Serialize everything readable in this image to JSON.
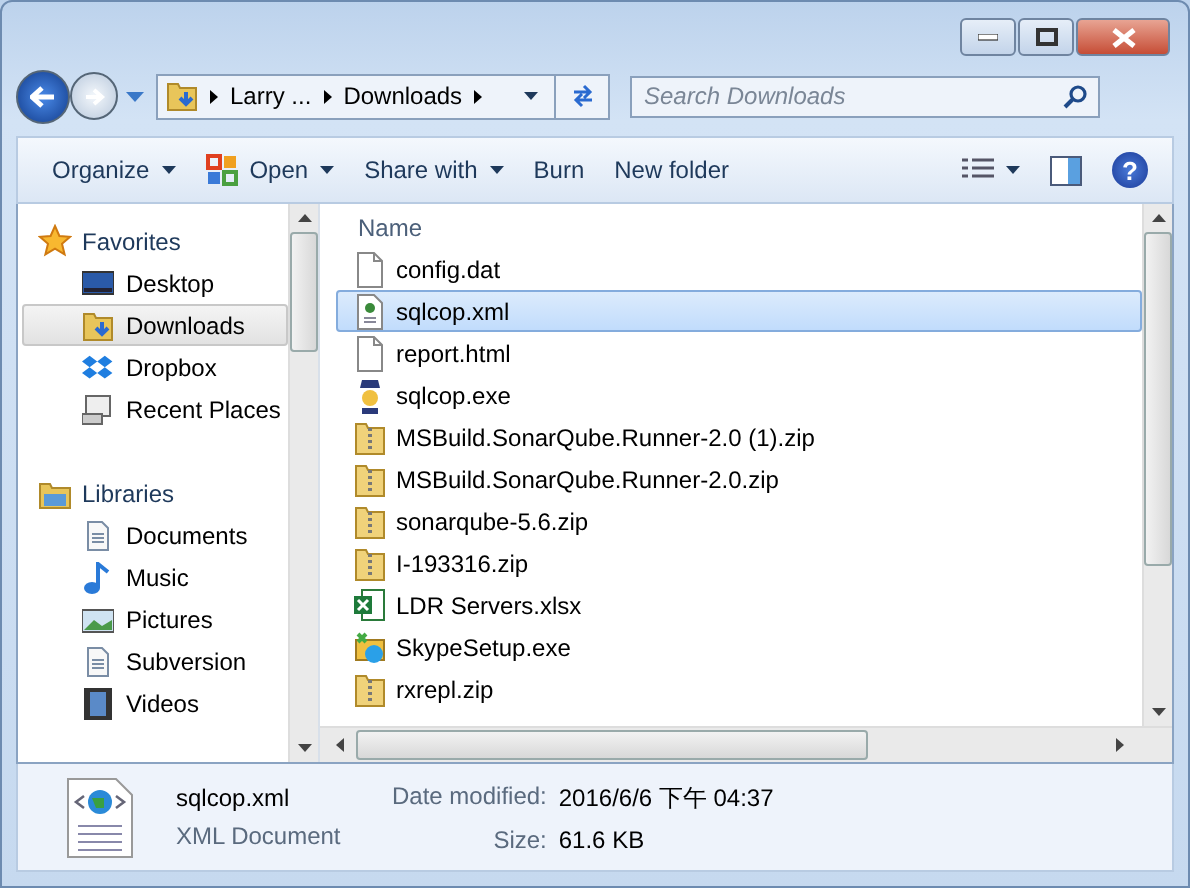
{
  "navigation": {
    "breadcrumb": [
      "Larry ...",
      "Downloads"
    ],
    "search": {
      "placeholder": "Search Downloads"
    }
  },
  "toolbar": [
    {
      "kind": "text",
      "label": "Organize",
      "dropdown": true
    },
    {
      "kind": "open",
      "label": "Open",
      "dropdown": true
    },
    {
      "kind": "text",
      "label": "Share with",
      "dropdown": true
    },
    {
      "kind": "text",
      "label": "Burn",
      "dropdown": false
    },
    {
      "kind": "text",
      "label": "New folder",
      "dropdown": false
    }
  ],
  "help_button": {
    "label": "?"
  },
  "sidebar": {
    "groups": [
      {
        "label": "Favorites",
        "kind": "star",
        "items": [
          {
            "label": "Desktop",
            "kind": "desktop",
            "selected": false
          },
          {
            "label": "Downloads",
            "kind": "downloads",
            "selected": true
          },
          {
            "label": "Dropbox",
            "kind": "dropbox",
            "selected": false
          },
          {
            "label": "Recent Places",
            "kind": "recent",
            "selected": false
          }
        ]
      },
      {
        "label": "Libraries",
        "kind": "library",
        "items": [
          {
            "label": "Documents",
            "kind": "documents",
            "selected": false
          },
          {
            "label": "Music",
            "kind": "music",
            "selected": false
          },
          {
            "label": "Pictures",
            "kind": "pictures",
            "selected": false
          },
          {
            "label": "Subversion",
            "kind": "documents",
            "selected": false
          },
          {
            "label": "Videos",
            "kind": "videos",
            "selected": false
          }
        ]
      }
    ]
  },
  "file_list": {
    "columns": [
      "Name"
    ],
    "rows": [
      {
        "name": "config.dat",
        "kind": "file",
        "selected": false
      },
      {
        "name": "sqlcop.xml",
        "kind": "xml",
        "selected": true
      },
      {
        "name": "report.html",
        "kind": "file",
        "selected": false
      },
      {
        "name": "sqlcop.exe",
        "kind": "exe",
        "selected": false
      },
      {
        "name": "MSBuild.SonarQube.Runner-2.0 (1).zip",
        "kind": "zip",
        "selected": false
      },
      {
        "name": "MSBuild.SonarQube.Runner-2.0.zip",
        "kind": "zip",
        "selected": false
      },
      {
        "name": "sonarqube-5.6.zip",
        "kind": "zip",
        "selected": false
      },
      {
        "name": "I-193316.zip",
        "kind": "zip",
        "selected": false
      },
      {
        "name": "LDR Servers.xlsx",
        "kind": "xlsx",
        "selected": false
      },
      {
        "name": "SkypeSetup.exe",
        "kind": "setup",
        "selected": false
      },
      {
        "name": "rxrepl.zip",
        "kind": "zip",
        "selected": false
      }
    ]
  },
  "details": {
    "name": "sqlcop.xml",
    "type": "XML Document",
    "fields": [
      {
        "label": "Date modified:",
        "value": "2016/6/6 下午 04:37"
      },
      {
        "label": "Size:",
        "value": "61.6 KB"
      }
    ]
  }
}
